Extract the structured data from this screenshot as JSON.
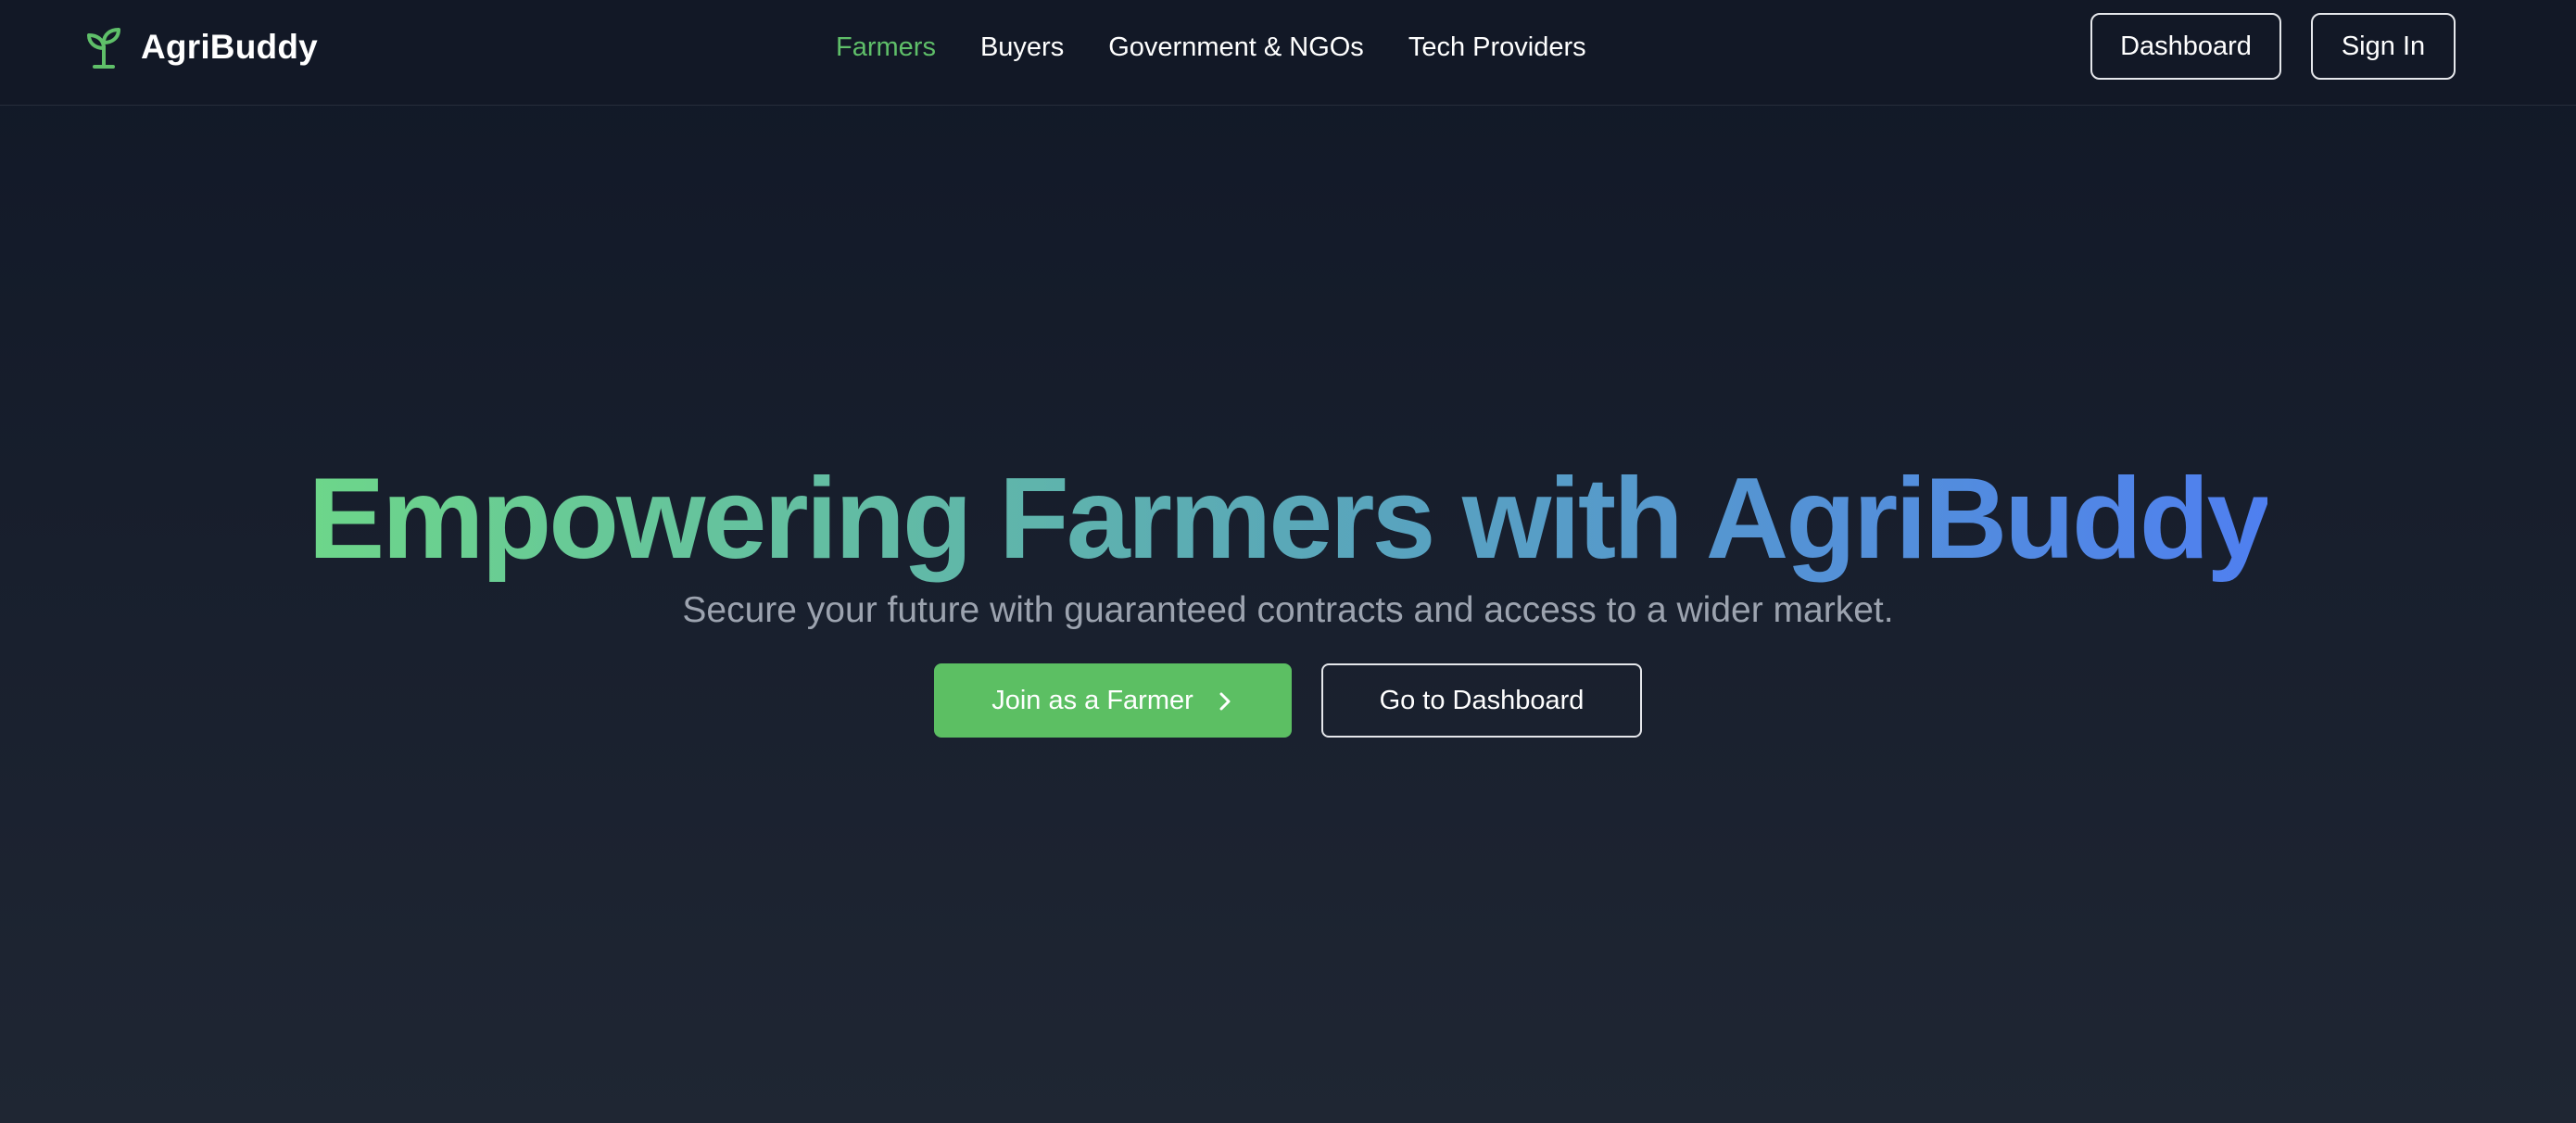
{
  "brand": {
    "name": "AgriBuddy",
    "icon": "sprout-icon",
    "accent_color": "#5fbf69"
  },
  "nav": {
    "links": [
      {
        "label": "Farmers",
        "active": true
      },
      {
        "label": "Buyers",
        "active": false
      },
      {
        "label": "Government & NGOs",
        "active": false
      },
      {
        "label": "Tech Providers",
        "active": false
      }
    ],
    "dashboard_label": "Dashboard",
    "signin_label": "Sign In"
  },
  "hero": {
    "title": "Empowering Farmers with AgriBuddy",
    "subtitle": "Secure your future with guaranteed contracts and access to a wider market.",
    "primary_cta": "Join as a Farmer",
    "primary_cta_icon": "chevron-right-icon",
    "secondary_cta": "Go to Dashboard",
    "gradient_colors": [
      "#6dd68a",
      "#5aa8b8",
      "#4f7ff0"
    ]
  },
  "colors": {
    "background_top": "#111827",
    "background_bottom": "#1f2633",
    "primary_button": "#5cbf63",
    "subtitle_text": "#9ca3af"
  }
}
